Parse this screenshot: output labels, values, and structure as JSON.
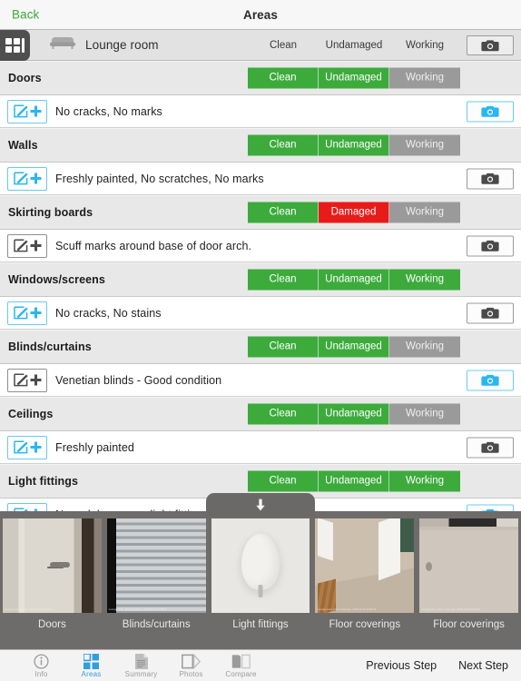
{
  "navbar": {
    "back_label": "Back",
    "title": "Areas"
  },
  "room_header": {
    "grid_icon": "grid-view-icon",
    "room_icon": "sofa-icon",
    "room_name": "Lounge room",
    "columns": [
      "Clean",
      "Undamaged",
      "Working"
    ],
    "camera_icon": "camera-icon"
  },
  "colors": {
    "green": "#3cab3c",
    "red": "#e81b1b",
    "gray": "#9a9a9a",
    "accent_blue": "#29b6f2",
    "back_green": "#3ba93b"
  },
  "items": [
    {
      "label": "Doors",
      "statuses": [
        {
          "label": "Clean",
          "state": "green"
        },
        {
          "label": "Undamaged",
          "state": "green"
        },
        {
          "label": "Working",
          "state": "gray"
        }
      ],
      "note": "No cracks, No marks",
      "edit_style": "blue",
      "camera_style": "blue"
    },
    {
      "label": "Walls",
      "statuses": [
        {
          "label": "Clean",
          "state": "green"
        },
        {
          "label": "Undamaged",
          "state": "green"
        },
        {
          "label": "Working",
          "state": "gray"
        }
      ],
      "note": "Freshly painted, No scratches, No marks",
      "edit_style": "blue",
      "camera_style": "dark"
    },
    {
      "label": "Skirting boards",
      "statuses": [
        {
          "label": "Clean",
          "state": "green"
        },
        {
          "label": "Damaged",
          "state": "red"
        },
        {
          "label": "Working",
          "state": "gray"
        }
      ],
      "note": "Scuff marks around base of door arch.",
      "edit_style": "dark",
      "camera_style": "dark"
    },
    {
      "label": "Windows/screens",
      "statuses": [
        {
          "label": "Clean",
          "state": "green"
        },
        {
          "label": "Undamaged",
          "state": "green"
        },
        {
          "label": "Working",
          "state": "green"
        }
      ],
      "note": "No cracks, No stains",
      "edit_style": "blue",
      "camera_style": "dark"
    },
    {
      "label": "Blinds/curtains",
      "statuses": [
        {
          "label": "Clean",
          "state": "green"
        },
        {
          "label": "Undamaged",
          "state": "green"
        },
        {
          "label": "Working",
          "state": "gray"
        }
      ],
      "note": "Venetian blinds - Good condition",
      "edit_style": "dark",
      "camera_style": "blue"
    },
    {
      "label": "Ceilings",
      "statuses": [
        {
          "label": "Clean",
          "state": "green"
        },
        {
          "label": "Undamaged",
          "state": "green"
        },
        {
          "label": "Working",
          "state": "gray"
        }
      ],
      "note": "Freshly painted",
      "edit_style": "blue",
      "camera_style": "dark"
    },
    {
      "label": "Light fittings",
      "statuses": [
        {
          "label": "Clean",
          "state": "green"
        },
        {
          "label": "Undamaged",
          "state": "green"
        },
        {
          "label": "Working",
          "state": "green"
        }
      ],
      "note": "New globes - new light fittings , No cracks",
      "edit_style": "blue",
      "camera_style": "blue"
    }
  ],
  "photo_drawer": {
    "handle_icon": "arrow-down-icon",
    "thumbnails": [
      {
        "label": "Doors",
        "scene": "sc-door",
        "stamp": "Lounge room, Doors, 2013-12-13 14:30:11"
      },
      {
        "label": "Blinds/curtains",
        "scene": "sc-blinds",
        "stamp": "Lounge room, Blinds/curtains, 2013-12-13 14:58:41"
      },
      {
        "label": "Light fittings",
        "scene": "sc-light",
        "stamp": "Lounge room, Light fittings, 2013-12-13 11:26:02"
      },
      {
        "label": "Floor coverings",
        "scene": "sc-floor1",
        "stamp": "Lounge room, Floor coverings, 2013-12-13 11:36:02"
      },
      {
        "label": "Floor coverings",
        "scene": "sc-floor2",
        "stamp": "Lounge room, Floor coverings, 2013-12-13 11:36:40"
      }
    ]
  },
  "tabbar": {
    "tabs": [
      {
        "label": "Info",
        "icon": "info-icon",
        "active": false
      },
      {
        "label": "Areas",
        "icon": "grid-icon",
        "active": true
      },
      {
        "label": "Summary",
        "icon": "document-icon",
        "active": false
      },
      {
        "label": "Photos",
        "icon": "photos-icon",
        "active": false
      },
      {
        "label": "Compare",
        "icon": "compare-icon",
        "active": false
      }
    ],
    "previous_step": "Previous Step",
    "next_step": "Next Step"
  }
}
